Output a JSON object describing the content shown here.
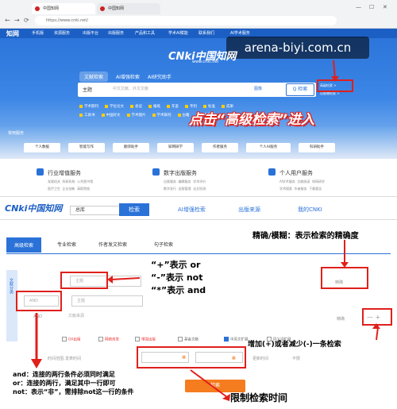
{
  "browser": {
    "tab_active": "中国知网",
    "tab_second": "中国知网",
    "address": "https://www.cnki.net/",
    "nav_back": "←",
    "nav_forward": "→",
    "nav_reload": "⟳",
    "win_min": "—",
    "win_max": "☐",
    "win_close": "✕"
  },
  "cnki_top": {
    "logo_text": "知网",
    "nav_items": [
      "手机版",
      "资源服务",
      "出版平台",
      "出版服务",
      "产品和工具",
      "学术AI赋能",
      "联系我们",
      "AI学术服务"
    ]
  },
  "hero": {
    "logo_big": "CNki中国知网",
    "logo_small": "www.cnki.net",
    "tabs": [
      "文献检索",
      "AI增强检索",
      "AI研究助手"
    ],
    "search_select": "主题",
    "search_placeholder": "中文文献、外文文献",
    "search_image_label": "图像",
    "search_button": "Q 检索",
    "adv_link": "高级检索 >",
    "adv_link2": "出版物检索 >",
    "checkboxes_row1": [
      "学术期刊",
      "学位论文",
      "会议",
      "报纸",
      "年鉴",
      "专利",
      "标准",
      "成果"
    ],
    "checkboxes_row2": [
      "工具书",
      "中国好文",
      "学术图片",
      "学术辑刊",
      "古籍",
      "特色期刊"
    ]
  },
  "callout_top": "点击“高级检索”进入",
  "watermark": "arena-biyi.com.cn",
  "tools": {
    "label": "常用服务",
    "items": [
      "个人数据",
      "智能写作",
      "翻译助手",
      "知网研学",
      "作者服务",
      "个人AI服务",
      "科研助手"
    ]
  },
  "services": [
    {
      "title": "行业增值服务",
      "subs": [
        "党政机关",
        "科研机构",
        "公共图书馆",
        "医疗卫生",
        "企业创新",
        "高职院校"
      ]
    },
    {
      "title": "数字出版服务",
      "subs": [
        "出版服务",
        "编辑服务",
        "学术评价",
        "数字发行",
        "出版管理",
        "论文检测"
      ]
    },
    {
      "title": "个人用户服务",
      "subs": [
        "AI学术服务",
        "文献阅读",
        "知网研学",
        "学术搜索",
        "作者服务",
        "下载报告"
      ]
    }
  ],
  "adv_header": {
    "logo": "CNki中国知网",
    "dropdown": "总库",
    "active_tab": "检索",
    "nav": [
      "AI增强检索",
      "出版来源",
      "我的CNKI"
    ]
  },
  "search_tabs": [
    "高级检索",
    "专业检索",
    "作者发文检索",
    "句子检索"
  ],
  "side_strip": "文献分类",
  "form": {
    "field1": "主题",
    "field2": "主题",
    "field3": "文献来源",
    "op": "AND",
    "op2": "AND",
    "precise": "精确",
    "precise2": "精确",
    "plus_minus": "—  +",
    "time_label": "时间范围:",
    "time_from": "发表时间",
    "time_to": "",
    "update_label": "更新时间",
    "update_value": "不限",
    "checks": [
      "OA出版",
      "网络首发",
      "增强出版",
      "基金文献",
      "中英文扩展",
      "同义词扩展"
    ],
    "search_button": "检索"
  },
  "annotations": {
    "precision": "精确/模糊：表示检索的精确度",
    "ops_line1": "“+”表示 or",
    "ops_line2": "“-”表示 not",
    "ops_line3": "“*”表示 and",
    "add_remove": "增加(+)或者减少(-)一条检索",
    "and_rule": "and：连接的两行条件必须同时满足",
    "or_rule": "or：连接的两行，满足其中一行即可",
    "not_rule": "not：表示“非”，需排除not这一行的条件",
    "time_limit": "限制检索时间"
  }
}
